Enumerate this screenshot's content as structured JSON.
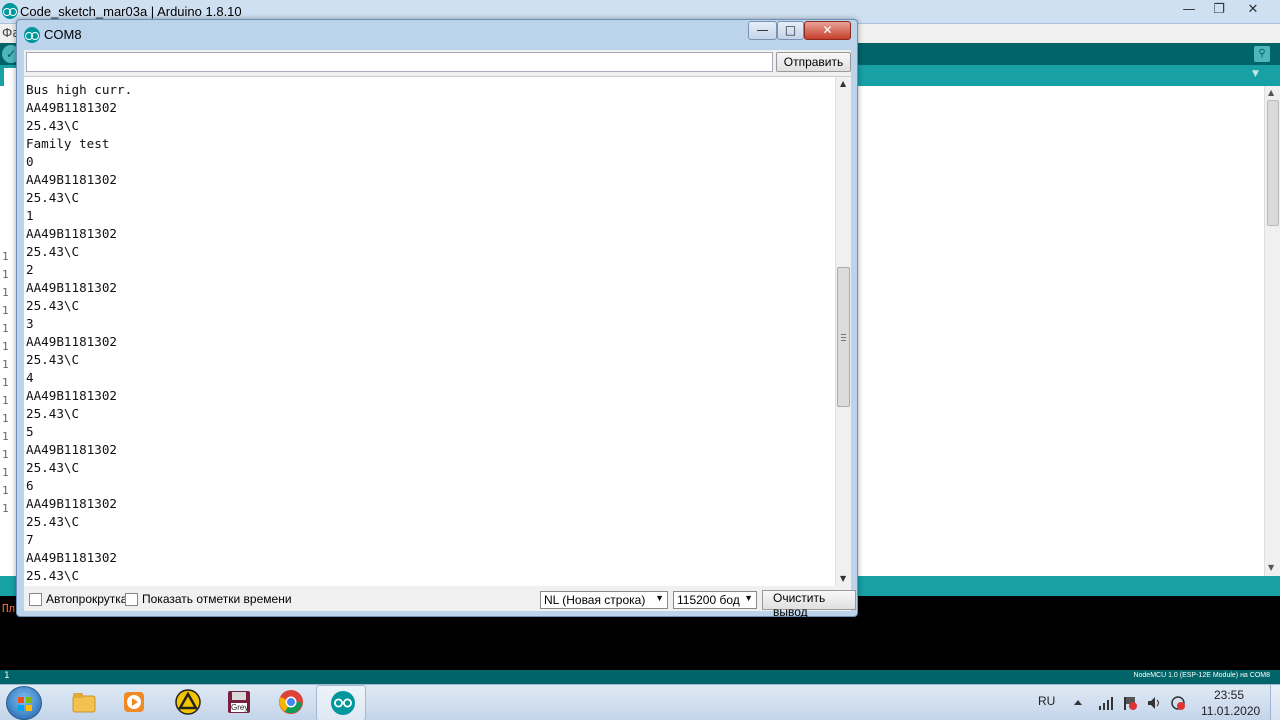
{
  "ide": {
    "title": "Code_sketch_mar03a | Arduino 1.8.10",
    "menu_first": "Фа",
    "console_text": "Пл",
    "gutter_numbers": [
      "1",
      "1",
      "1",
      "1",
      "1",
      "1",
      "1",
      "1",
      "1",
      "1",
      "1",
      "1",
      "1",
      "1",
      "1"
    ],
    "footer_line": "1",
    "footer_board": "NodeMCU 1.0 (ESP-12E Module) на COM8"
  },
  "monitor": {
    "title": "COM8",
    "send_value": "",
    "send_label": "Отправить",
    "output_lines": [
      "Bus high curr.",
      "AA49B1181302",
      "25.43\\C",
      "Family test",
      "0",
      "AA49B1181302",
      "25.43\\C",
      "1",
      "AA49B1181302",
      "25.43\\C",
      "2",
      "AA49B1181302",
      "25.43\\C",
      "3",
      "AA49B1181302",
      "25.43\\C",
      "4",
      "AA49B1181302",
      "25.43\\C",
      "5",
      "AA49B1181302",
      "25.43\\C",
      "6",
      "AA49B1181302",
      "25.43\\C",
      "7",
      "AA49B1181302",
      "25.43\\C"
    ],
    "autoscroll_label": "Автопрокрутка",
    "timestamp_label": "Показать отметки времени",
    "line_ending": "NL (Новая строка)",
    "baud": "115200 бод",
    "clear_label": "Очистить вывод"
  },
  "taskbar": {
    "apps": [
      {
        "name": "explorer-icon",
        "color": "#f2c14e"
      },
      {
        "name": "media-player-icon",
        "color": "#f08a24"
      },
      {
        "name": "archicad-icon",
        "color": "#f5c400"
      },
      {
        "name": "grey-disk-icon",
        "color": "#7a1f3d",
        "label": "Grey"
      },
      {
        "name": "chrome-icon",
        "color": "#db4437"
      },
      {
        "name": "arduino-icon",
        "color": "#00979c"
      }
    ],
    "lang": "RU",
    "time": "23:55",
    "date": "11.01.2020"
  },
  "colors": {
    "teal_dark": "#006468",
    "teal": "#17a1a5",
    "window_frame": "#bcd3ec",
    "close_red": "#c6402c"
  }
}
